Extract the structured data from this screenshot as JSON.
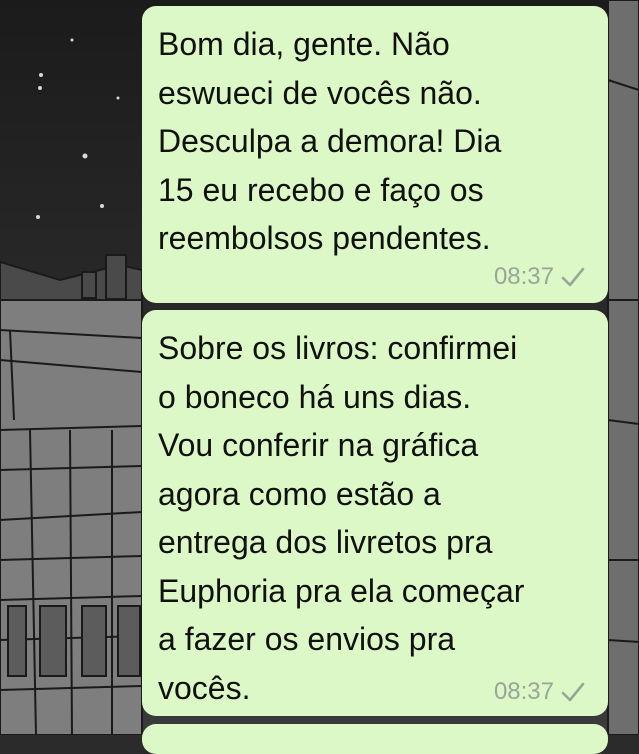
{
  "messages": [
    {
      "text": "Bom dia, gente. Não\neswueci de vocês não.\nDesculpa a demora! Dia\n15 eu recebo e faço os\nreembolsos pendentes.",
      "time": "08:37",
      "status_icon": "single-check-icon"
    },
    {
      "text": "Sobre os livros: confirmei\no boneco há uns dias.\nVou conferir na gráfica\nagora como estão a\nentrega dos livretos pra\nEuphoria pra ela começar\na fazer os envios pra\nvocês.",
      "time": "08:37",
      "status_icon": "single-check-icon"
    },
    {
      "text": "",
      "time": ""
    }
  ],
  "colors": {
    "bubble_outgoing": "#dcf8c6",
    "meta_text": "#9aa59a",
    "wallpaper_dark": "#1f1f1f",
    "wallpaper_light": "#8f8f8f"
  }
}
